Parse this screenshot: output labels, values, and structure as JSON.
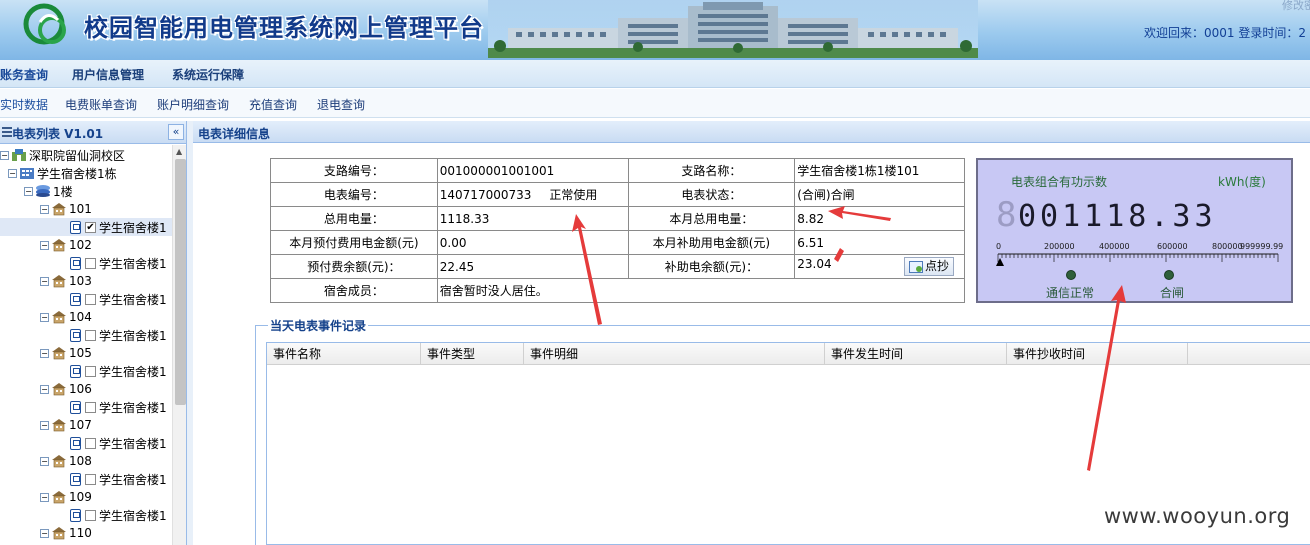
{
  "header": {
    "title": "校园智能用电管理系统网上管理平台",
    "welcome": "欢迎回来：0001   登录时间：2",
    "modify": "修改密"
  },
  "menu": {
    "items": [
      {
        "label": "账务查询"
      },
      {
        "label": "用户信息管理"
      },
      {
        "label": "系统运行保障"
      }
    ]
  },
  "submenu": {
    "items": [
      {
        "label": "实时数据"
      },
      {
        "label": "电费账单查询"
      },
      {
        "label": "账户明细查询"
      },
      {
        "label": "充值查询"
      },
      {
        "label": "退电查询"
      }
    ]
  },
  "sidebar": {
    "title": "电表列表 V1.01",
    "collapse_label": "«",
    "tree": {
      "campus": "深职院留仙洞校区",
      "building": "学生宿舍楼1栋",
      "floor": "1楼",
      "rooms": [
        {
          "room": "101",
          "meter": "学生宿舍楼1",
          "checked": true
        },
        {
          "room": "102",
          "meter": "学生宿舍楼1",
          "checked": false
        },
        {
          "room": "103",
          "meter": "学生宿舍楼1",
          "checked": false
        },
        {
          "room": "104",
          "meter": "学生宿舍楼1",
          "checked": false
        },
        {
          "room": "105",
          "meter": "学生宿舍楼1",
          "checked": false
        },
        {
          "room": "106",
          "meter": "学生宿舍楼1",
          "checked": false
        },
        {
          "room": "107",
          "meter": "学生宿舍楼1",
          "checked": false
        },
        {
          "room": "108",
          "meter": "学生宿舍楼1",
          "checked": false
        },
        {
          "room": "109",
          "meter": "学生宿舍楼1",
          "checked": false
        },
        {
          "room": "110",
          "meter": "",
          "checked": false
        }
      ]
    }
  },
  "detail": {
    "title": "电表详细信息",
    "branch_no_label": "支路编号：",
    "branch_no": "001000001001001",
    "branch_name_label": "支路名称：",
    "branch_name": "学生宿舍楼1栋1楼101",
    "meter_no_label": "电表编号：",
    "meter_no": "140717000733",
    "meter_use": "正常使用",
    "meter_status_label": "电表状态：",
    "meter_status": "(合闸)合闸",
    "total_power_label": "总用电量：",
    "total_power": "1118.33",
    "month_power_label": "本月总用电量：",
    "month_power": "8.82",
    "prepaid_month_label": "本月预付费用电金额(元)",
    "prepaid_month": "0.00",
    "subsidy_month_label": "本月补助用电金额(元)",
    "subsidy_month": "6.51",
    "prepaid_balance_label": "预付费余额(元)：",
    "prepaid_balance": "22.45",
    "subsidy_balance_label": "补助电余额(元)：",
    "subsidy_balance": "23.04",
    "read_button": "点抄",
    "members_label": "宿舍成员：",
    "members": "宿舍暂时没人居住。"
  },
  "lcd": {
    "label": "电表组合有功示数",
    "unit": "kWh(度)",
    "reading": "001118.33",
    "scale": [
      "0",
      "200000",
      "400000",
      "600000",
      "800000",
      "999999.99"
    ],
    "lamp1": "通信正常",
    "lamp2": "合闸",
    "lamp_color": "#2f5f3a"
  },
  "events": {
    "title": "当天电表事件记录",
    "columns": [
      "事件名称",
      "事件类型",
      "事件明细",
      "事件发生时间",
      "事件抄收时间"
    ]
  },
  "watermark": "www.wooyun.org",
  "colors": {
    "accent": "#15428b",
    "arrow": "#e53b3b",
    "lcd_bg": "#c8c8f4"
  }
}
